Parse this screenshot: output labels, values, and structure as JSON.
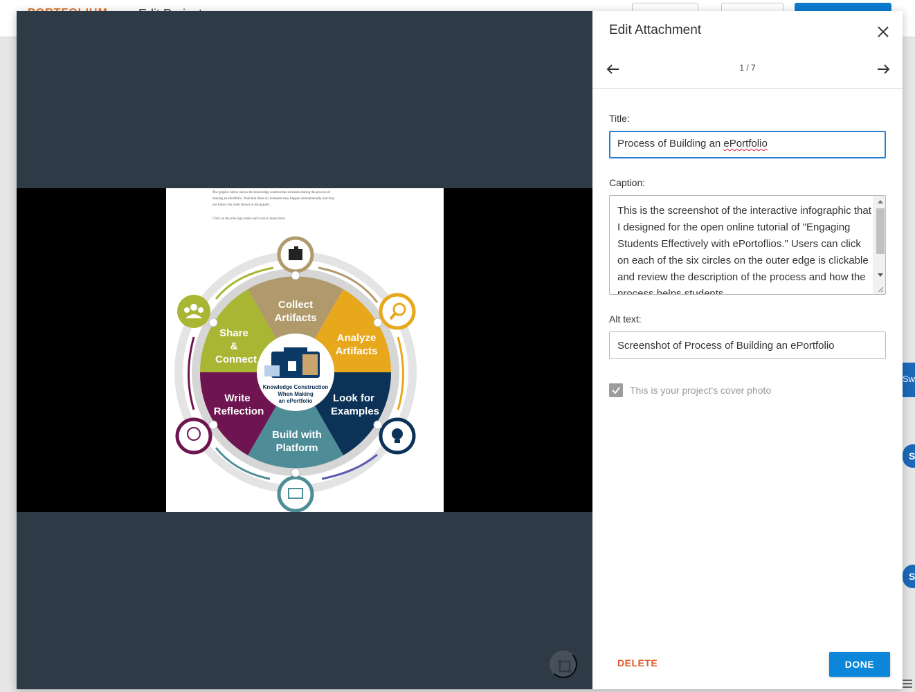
{
  "background": {
    "app_logo": "PORTFOLIUM",
    "page_title": "Edit Project",
    "side_tab_text": "Swa",
    "avatar_letter": "S"
  },
  "panel": {
    "title": "Edit Attachment",
    "pager": "1 / 7",
    "title_label": "Title:",
    "title_value_prefix": "Process of Building an ",
    "title_value_word": "ePortfolio",
    "caption_label": "Caption:",
    "caption_value": "This is the screenshot of the interactive infographic that I designed for the open online tutorial of \"Engaging Students Effectively with ePortoflios.\" Users can click on each of the six circles on the outer edge is clickable and review the description of the process and how the process helps students",
    "alt_label": "Alt text:",
    "alt_value": "Screenshot of Process of Building an ePortfolio",
    "cover_label": "This is your project's cover photo",
    "cover_checked": true,
    "delete_label": "DELETE",
    "done_label": "DONE"
  },
  "infographic": {
    "intro_line1": "The graphic below shows the knowledge construction elements during the process of",
    "intro_line2": "making an ePortfolio. Note that these six elements may happen simultaneously and may",
    "intro_line3": "not follow the order shown in the graphic.",
    "intro_line4": "Click on the plus sign under each icon to learn more.",
    "center_line1": "Knowledge Construction",
    "center_line2": "When Making",
    "center_line3": "an ePortfolio",
    "segments": [
      {
        "line1": "Collect",
        "line2": "Artifacts",
        "color": "#b09a6b"
      },
      {
        "line1": "Analyze",
        "line2": "Artifacts",
        "color": "#e8a81c"
      },
      {
        "line1": "Look for",
        "line2": "Examples",
        "color": "#0c3357"
      },
      {
        "line1": "Build with",
        "line2": "Platform",
        "color": "#4e8c98"
      },
      {
        "line1": "Write",
        "line2": "Reflection",
        "color": "#6e1450"
      },
      {
        "line1": "Share",
        "line2": "&",
        "line3": "Connect",
        "color": "#a8b634"
      }
    ]
  },
  "colors": {
    "accent": "#0b86d8",
    "delete": "#e05a2b",
    "viewer_bg": "#2e3a46"
  }
}
